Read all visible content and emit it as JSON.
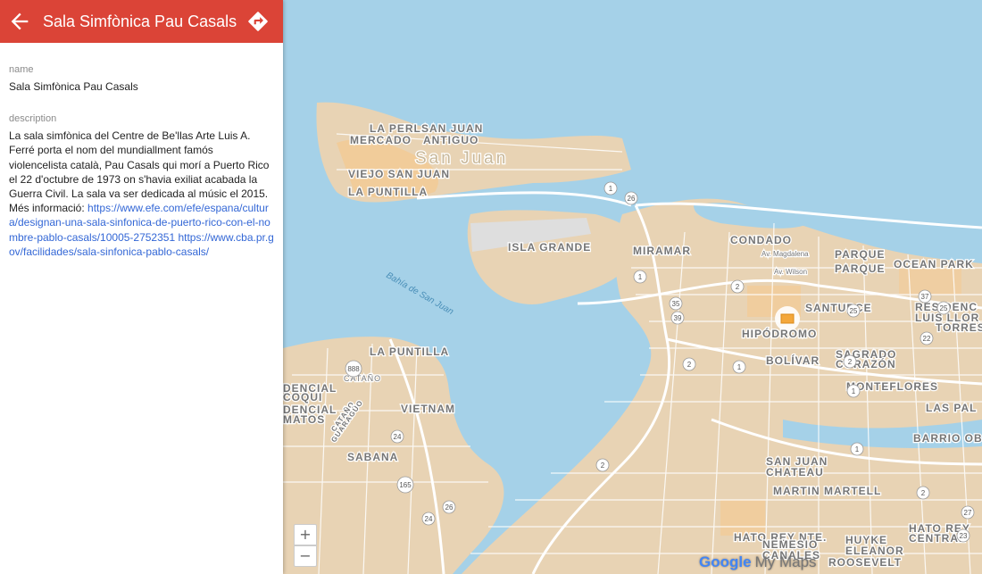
{
  "header": {
    "title": "Sala Simfònica Pau Casals",
    "back_icon": "arrow-left-icon",
    "directions_icon": "directions-icon",
    "bar_color": "#db4437"
  },
  "details": {
    "name_label": "name",
    "name_value": "Sala Simfònica Pau Casals",
    "description_label": "description",
    "description_text": "La sala simfònica del Centre de Be'llas Arte Luis A. Ferré porta el nom del mundiallment famós violencelista català, Pau Casals qui morí a Puerto Rico el 22 d'octubre de 1973 on s'havia exiliat acabada la Guerra Civil. La sala va ser dedicada al músic el 2015.",
    "more_info_prefix": "Més informació:",
    "link1": "https://www.efe.com/efe/espana/cultura/designan-una-sala-sinfonica-de-puerto-rico-con-el-nombre-pablo-casals/10005-2752351",
    "link2": "https://www.cba.pr.gov/facilidades/sala-sinfonica-pablo-casals/"
  },
  "map": {
    "place_labels": [
      "LA PERLA",
      "SAN JUAN",
      "MERCADO",
      "ANTIGUO",
      "San Juan",
      "VIEJO SAN JUAN",
      "LA PUNTILLA",
      "ISLA GRANDE",
      "MIRAMAR",
      "CONDADO",
      "PARQUE",
      "PARQUE",
      "OCEAN PARK",
      "SANTURCE",
      "HIPÓDROMO",
      "BOLÍVAR",
      "SAGRADO",
      "CORAZÓN",
      "MONTEFLORES",
      "LAS PAL",
      "BARRIO OB",
      "LA PUNTILLA",
      "CATAÑO",
      "VIETNAM",
      "SABANA",
      "SAN JUAN",
      "CHATEAU",
      "MARTIN MARTELL",
      "HATO REY NTE.",
      "HUYKE",
      "NEMESIO",
      "CANALES",
      "ELEANOR",
      "ROOSEVELT",
      "HATO REY",
      "CENTRAL",
      "RESIDENC",
      "LUIS LLOR",
      "TORRES",
      "DENCIAL",
      "COQUI",
      "DENCIAL",
      "MATOS",
      "CATAÑO",
      "GUARAGÜO",
      "Av. Magdalena",
      "Av. Wilson"
    ],
    "water_label": "Bahía de San Juan",
    "route_shields": [
      "1",
      "26",
      "1",
      "2",
      "39",
      "35",
      "2",
      "1",
      "37",
      "22",
      "25",
      "1",
      "888",
      "24",
      "165",
      "24",
      "26",
      "2",
      "2",
      "1",
      "2",
      "27",
      "23",
      "25"
    ],
    "marker_icon": "building-marker-icon",
    "marker_color": "#f4a73b",
    "zoom_in_label": "+",
    "zoom_out_label": "−",
    "brand_google": "Google",
    "brand_mymaps": "My Maps",
    "water_color": "#a5d1e8",
    "land_color": "#e8d3b4"
  }
}
